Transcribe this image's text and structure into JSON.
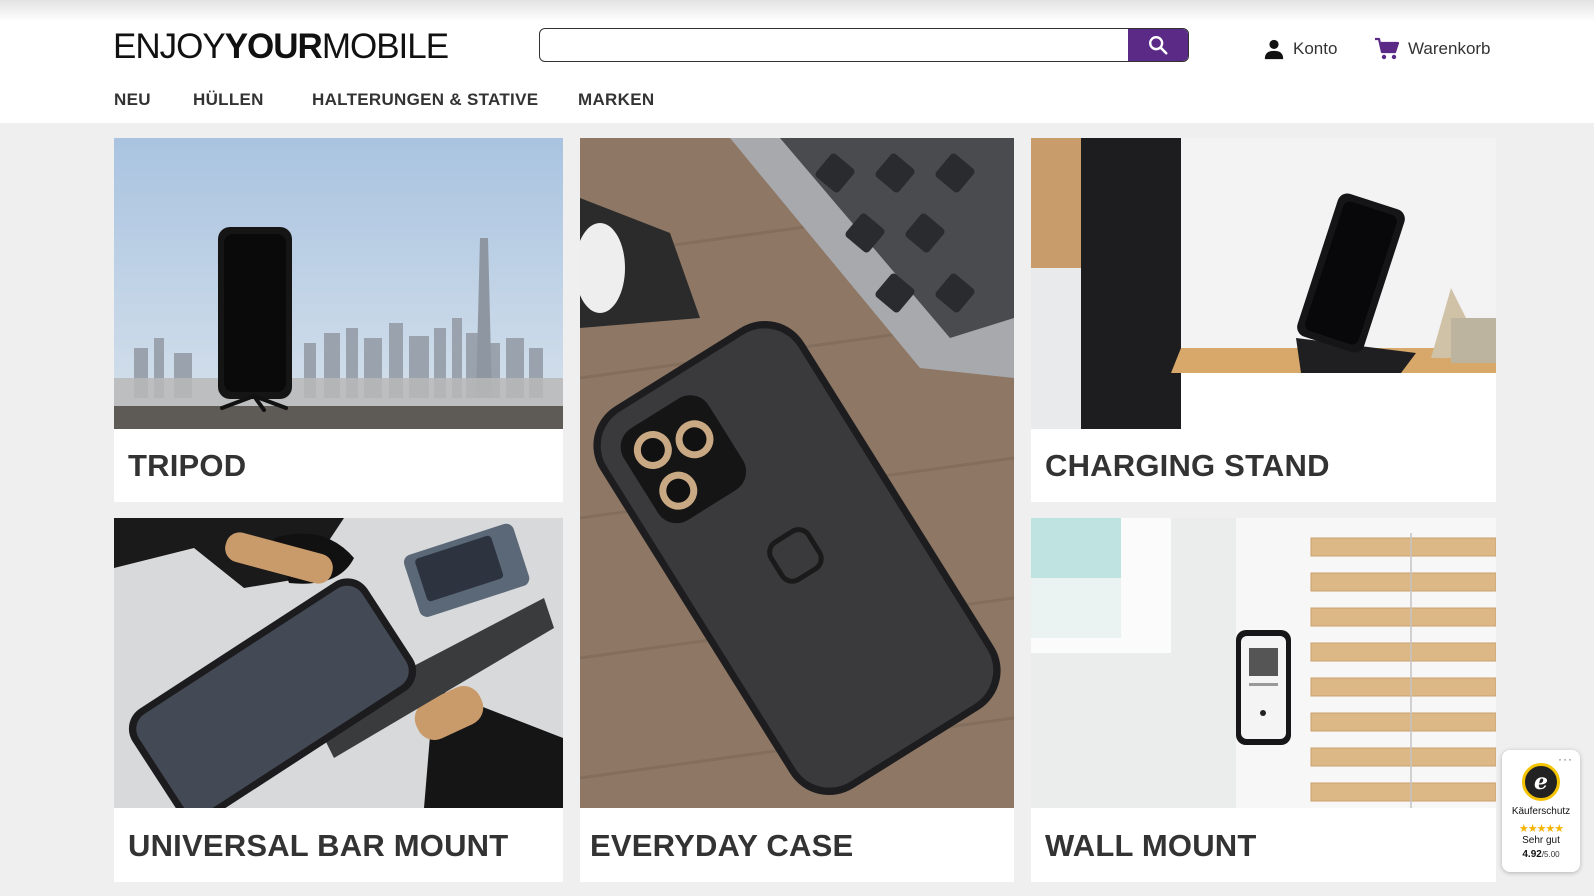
{
  "header": {
    "logo": {
      "part1": "ENJOY",
      "part2": "YOUR",
      "part3": "MOBILE"
    },
    "search": {
      "placeholder": "",
      "value": ""
    },
    "account_label": "Konto",
    "cart_label": "Warenkorb"
  },
  "nav": {
    "items": [
      {
        "label": "NEU"
      },
      {
        "label": "HÜLLEN"
      },
      {
        "label": "HALTERUNGEN & STATIVE"
      },
      {
        "label": "MARKEN"
      }
    ]
  },
  "tiles": [
    {
      "label": "TRIPOD"
    },
    {
      "label": "EVERYDAY CASE"
    },
    {
      "label": "CHARGING STAND"
    },
    {
      "label": "UNIVERSAL BAR MOUNT"
    },
    {
      "label": "WALL MOUNT"
    }
  ],
  "trust_badge": {
    "menu": "···",
    "seal_letter": "e",
    "title": "Käuferschutz",
    "stars": "★★★★★",
    "rating_text": "Sehr gut",
    "score": "4.92",
    "score_max": "/5.00"
  },
  "colors": {
    "accent": "#5b2a86",
    "text": "#333333",
    "background": "#efefef"
  }
}
